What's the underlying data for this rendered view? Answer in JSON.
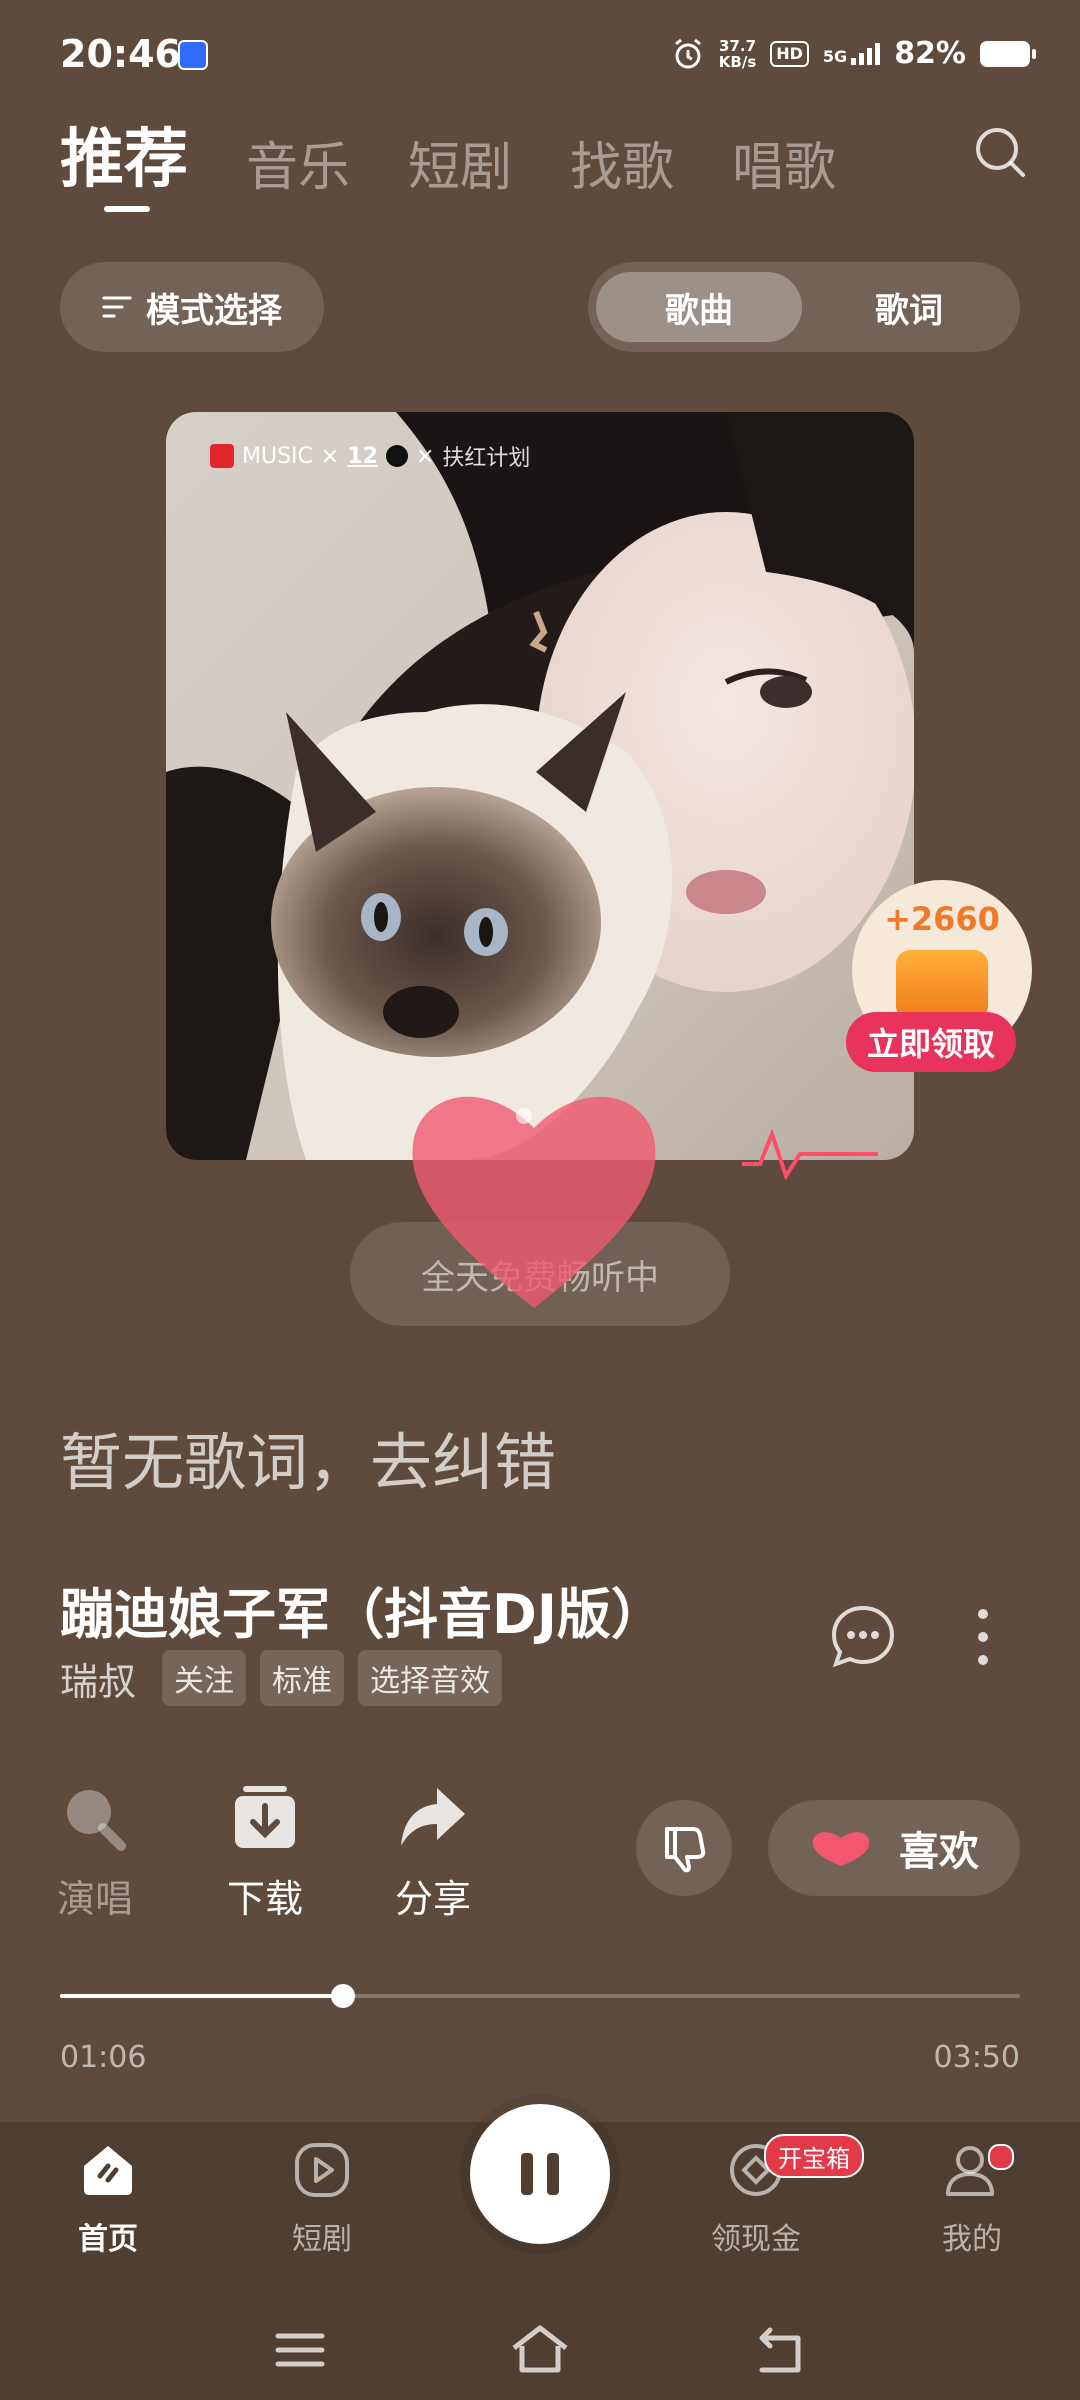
{
  "status_bar": {
    "time": "20:46",
    "speed_value": "37.7",
    "speed_unit": "KB/s",
    "hd": "HD",
    "network": "5G",
    "battery": "82%"
  },
  "top_tabs": [
    {
      "label": "推荐",
      "active": true
    },
    {
      "label": "音乐",
      "active": false
    },
    {
      "label": "短剧",
      "active": false
    },
    {
      "label": "找歌",
      "active": false
    },
    {
      "label": "唱歌",
      "active": false
    }
  ],
  "mode": {
    "button_label": "模式选择",
    "segment_song": "歌曲",
    "segment_lyrics": "歌词"
  },
  "album": {
    "badge_music": "MUSIC",
    "badge_x": "×",
    "badge_brand": "12",
    "badge_plan": "扶红计划"
  },
  "coin_widget": {
    "amount": "+2660",
    "claim_label": "立即领取"
  },
  "free_listen": "全天免费畅听中",
  "no_lyrics": "暂无歌词，去纠错",
  "song": {
    "title": "蹦迪娘子军（抖音DJ版）",
    "artist": "瑞叔",
    "chips": [
      "关注",
      "标准",
      "选择音效"
    ]
  },
  "actions": {
    "sing": "演唱",
    "download": "下载",
    "share": "分享",
    "like": "喜欢"
  },
  "playback": {
    "current_time": "01:06",
    "total_time": "03:50",
    "progress": 0.295
  },
  "bottom_nav": {
    "home": "首页",
    "drama": "短剧",
    "cash": "领现金",
    "cash_badge": "开宝箱",
    "mine": "我的"
  },
  "colors": {
    "background": "#5e4b3e",
    "nav_background": "#4f3e32",
    "accent_red": "#e33a4a",
    "coin_orange": "#f07a2a"
  }
}
